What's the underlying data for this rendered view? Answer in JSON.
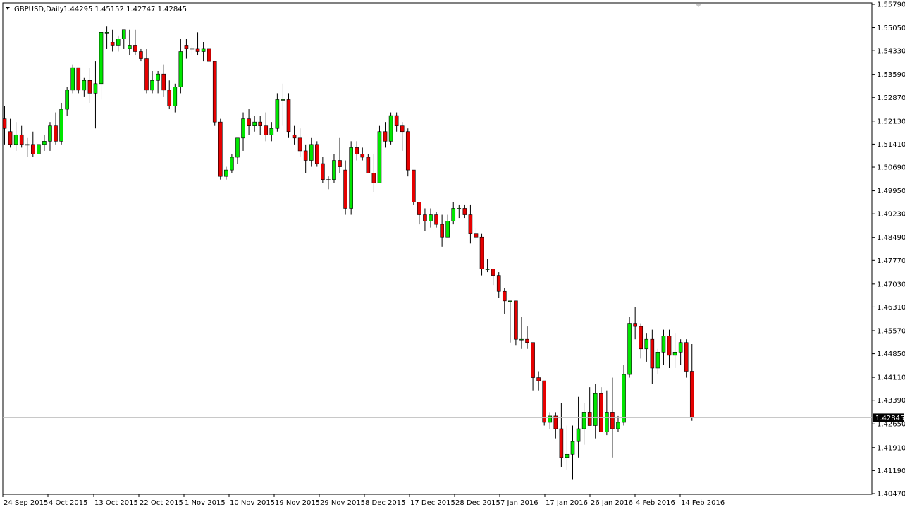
{
  "header": {
    "symbol": "GBPUSD,Daily",
    "ohlc": "1.44295 1.45152 1.42747 1.42845"
  },
  "colors": {
    "background": "#ffffff",
    "frame": "#000000",
    "bull": "#00e600",
    "bear": "#e60000",
    "wick": "#000000",
    "current_price_line": "#c0c0c0",
    "price_badge_bg": "#000000",
    "price_badge_text": "#ffffff"
  },
  "chart_data": {
    "type": "candlestick",
    "symbol": "GBPUSD",
    "timeframe": "Daily",
    "grid": false,
    "y_ticks": [
      "1.55790",
      "1.55050",
      "1.54330",
      "1.53590",
      "1.52870",
      "1.52130",
      "1.51410",
      "1.50690",
      "1.49950",
      "1.49230",
      "1.48490",
      "1.47770",
      "1.47030",
      "1.46310",
      "1.45570",
      "1.44850",
      "1.44110",
      "1.43390",
      "1.42650",
      "1.41910",
      "1.41190",
      "1.40470"
    ],
    "ylim": [
      1.4047,
      1.5579
    ],
    "x_labels": [
      "24 Sep 2015",
      "4 Oct 2015",
      "13 Oct 2015",
      "22 Oct 2015",
      "1 Nov 2015",
      "10 Nov 2015",
      "19 Nov 2015",
      "29 Nov 2015",
      "8 Dec 2015",
      "17 Dec 2015",
      "28 Dec 2015",
      "7 Jan 2016",
      "17 Jan 2016",
      "26 Jan 2016",
      "4 Feb 2016",
      "14 Feb 2016"
    ],
    "current_price": "1.42845",
    "candles": [
      [
        1.522,
        1.526,
        1.514,
        1.519
      ],
      [
        1.518,
        1.522,
        1.513,
        1.514
      ],
      [
        1.514,
        1.521,
        1.512,
        1.517
      ],
      [
        1.517,
        1.52,
        1.513,
        1.514
      ],
      [
        1.514,
        1.516,
        1.51,
        1.514
      ],
      [
        1.514,
        1.518,
        1.51,
        1.511
      ],
      [
        1.511,
        1.514,
        1.511,
        1.514
      ],
      [
        1.514,
        1.517,
        1.512,
        1.515
      ],
      [
        1.515,
        1.521,
        1.512,
        1.52
      ],
      [
        1.52,
        1.524,
        1.514,
        1.515
      ],
      [
        1.515,
        1.527,
        1.514,
        1.525
      ],
      [
        1.525,
        1.532,
        1.523,
        1.531
      ],
      [
        1.531,
        1.539,
        1.53,
        1.538
      ],
      [
        1.538,
        1.538,
        1.53,
        1.531
      ],
      [
        1.531,
        1.535,
        1.529,
        1.534
      ],
      [
        1.534,
        1.538,
        1.527,
        1.53
      ],
      [
        1.53,
        1.54,
        1.519,
        1.533
      ],
      [
        1.533,
        1.549,
        1.528,
        1.549
      ],
      [
        1.549,
        1.551,
        1.544,
        1.549
      ],
      [
        1.546,
        1.55,
        1.543,
        1.545
      ],
      [
        1.545,
        1.548,
        1.543,
        1.547
      ],
      [
        1.547,
        1.55,
        1.544,
        1.55
      ],
      [
        1.544,
        1.55,
        1.542,
        1.545
      ],
      [
        1.545,
        1.55,
        1.542,
        1.543
      ],
      [
        1.543,
        1.544,
        1.54,
        1.541
      ],
      [
        1.541,
        1.544,
        1.53,
        1.531
      ],
      [
        1.531,
        1.537,
        1.53,
        1.534
      ],
      [
        1.534,
        1.537,
        1.53,
        1.536
      ],
      [
        1.536,
        1.539,
        1.529,
        1.531
      ],
      [
        1.531,
        1.534,
        1.525,
        1.526
      ],
      [
        1.526,
        1.533,
        1.524,
        1.532
      ],
      [
        1.532,
        1.547,
        1.53,
        1.543
      ],
      [
        1.545,
        1.547,
        1.541,
        1.544
      ],
      [
        1.544,
        1.545,
        1.542,
        1.544
      ],
      [
        1.544,
        1.549,
        1.542,
        1.543
      ],
      [
        1.543,
        1.546,
        1.54,
        1.544
      ],
      [
        1.544,
        1.544,
        1.54,
        1.54
      ],
      [
        1.54,
        1.54,
        1.52,
        1.521
      ],
      [
        1.521,
        1.522,
        1.503,
        1.504
      ],
      [
        1.504,
        1.507,
        1.503,
        1.506
      ],
      [
        1.506,
        1.511,
        1.505,
        1.51
      ],
      [
        1.51,
        1.516,
        1.508,
        1.516
      ],
      [
        1.516,
        1.524,
        1.512,
        1.522
      ],
      [
        1.522,
        1.525,
        1.517,
        1.52
      ],
      [
        1.52,
        1.523,
        1.518,
        1.521
      ],
      [
        1.521,
        1.523,
        1.517,
        1.52
      ],
      [
        1.52,
        1.524,
        1.515,
        1.517
      ],
      [
        1.517,
        1.521,
        1.515,
        1.519
      ],
      [
        1.519,
        1.53,
        1.518,
        1.528
      ],
      [
        1.528,
        1.533,
        1.52,
        1.528
      ],
      [
        1.528,
        1.53,
        1.516,
        1.518
      ],
      [
        1.517,
        1.52,
        1.514,
        1.516
      ],
      [
        1.516,
        1.519,
        1.51,
        1.512
      ],
      [
        1.512,
        1.514,
        1.505,
        1.509
      ],
      [
        1.509,
        1.516,
        1.507,
        1.514
      ],
      [
        1.514,
        1.515,
        1.507,
        1.508
      ],
      [
        1.508,
        1.51,
        1.502,
        1.503
      ],
      [
        1.503,
        1.504,
        1.5,
        1.503
      ],
      [
        1.503,
        1.511,
        1.502,
        1.509
      ],
      [
        1.509,
        1.516,
        1.505,
        1.507
      ],
      [
        1.506,
        1.509,
        1.492,
        1.494
      ],
      [
        1.494,
        1.515,
        1.492,
        1.513
      ],
      [
        1.513,
        1.515,
        1.509,
        1.511
      ],
      [
        1.511,
        1.513,
        1.509,
        1.51
      ],
      [
        1.51,
        1.511,
        1.505,
        1.505
      ],
      [
        1.505,
        1.511,
        1.499,
        1.502
      ],
      [
        1.502,
        1.52,
        1.502,
        1.518
      ],
      [
        1.518,
        1.521,
        1.513,
        1.515
      ],
      [
        1.515,
        1.524,
        1.514,
        1.523
      ],
      [
        1.523,
        1.524,
        1.518,
        1.52
      ],
      [
        1.52,
        1.521,
        1.512,
        1.518
      ],
      [
        1.518,
        1.519,
        1.504,
        1.506
      ],
      [
        1.506,
        1.506,
        1.495,
        1.496
      ],
      [
        1.496,
        1.496,
        1.489,
        1.492
      ],
      [
        1.492,
        1.494,
        1.487,
        1.49
      ],
      [
        1.49,
        1.494,
        1.488,
        1.492
      ],
      [
        1.492,
        1.493,
        1.488,
        1.489
      ],
      [
        1.489,
        1.492,
        1.482,
        1.485
      ],
      [
        1.485,
        1.492,
        1.485,
        1.49
      ],
      [
        1.49,
        1.496,
        1.489,
        1.494
      ],
      [
        1.494,
        1.495,
        1.491,
        1.494
      ],
      [
        1.494,
        1.495,
        1.491,
        1.492
      ],
      [
        1.492,
        1.495,
        1.483,
        1.486
      ],
      [
        1.486,
        1.488,
        1.484,
        1.485
      ],
      [
        1.485,
        1.486,
        1.473,
        1.475
      ],
      [
        1.475,
        1.478,
        1.474,
        1.475
      ],
      [
        1.475,
        1.475,
        1.47,
        1.473
      ],
      [
        1.473,
        1.474,
        1.466,
        1.468
      ],
      [
        1.468,
        1.469,
        1.461,
        1.465
      ],
      [
        1.465,
        1.465,
        1.452,
        1.465
      ],
      [
        1.465,
        1.465,
        1.451,
        1.453
      ],
      [
        1.453,
        1.46,
        1.45,
        1.453
      ],
      [
        1.453,
        1.457,
        1.45,
        1.452
      ],
      [
        1.452,
        1.452,
        1.437,
        1.441
      ],
      [
        1.441,
        1.443,
        1.437,
        1.44
      ],
      [
        1.44,
        1.44,
        1.426,
        1.427
      ],
      [
        1.427,
        1.43,
        1.425,
        1.429
      ],
      [
        1.429,
        1.43,
        1.422,
        1.425
      ],
      [
        1.425,
        1.433,
        1.413,
        1.416
      ],
      [
        1.416,
        1.426,
        1.412,
        1.417
      ],
      [
        1.417,
        1.426,
        1.409,
        1.421
      ],
      [
        1.421,
        1.435,
        1.416,
        1.425
      ],
      [
        1.425,
        1.433,
        1.42,
        1.43
      ],
      [
        1.43,
        1.438,
        1.426,
        1.426
      ],
      [
        1.426,
        1.439,
        1.422,
        1.436
      ],
      [
        1.436,
        1.438,
        1.424,
        1.424
      ],
      [
        1.424,
        1.437,
        1.423,
        1.43
      ],
      [
        1.43,
        1.441,
        1.416,
        1.425
      ],
      [
        1.425,
        1.429,
        1.424,
        1.427
      ],
      [
        1.427,
        1.445,
        1.426,
        1.442
      ],
      [
        1.442,
        1.46,
        1.441,
        1.458
      ],
      [
        1.458,
        1.463,
        1.453,
        1.457
      ],
      [
        1.457,
        1.458,
        1.447,
        1.45
      ],
      [
        1.45,
        1.455,
        1.446,
        1.453
      ],
      [
        1.453,
        1.456,
        1.439,
        1.444
      ],
      [
        1.444,
        1.45,
        1.442,
        1.449
      ],
      [
        1.449,
        1.456,
        1.445,
        1.454
      ],
      [
        1.454,
        1.456,
        1.444,
        1.448
      ],
      [
        1.448,
        1.455,
        1.444,
        1.449
      ],
      [
        1.449,
        1.453,
        1.445,
        1.452
      ],
      [
        1.452,
        1.453,
        1.441,
        1.443
      ],
      [
        1.443,
        1.4515,
        1.4275,
        1.4285
      ]
    ]
  }
}
